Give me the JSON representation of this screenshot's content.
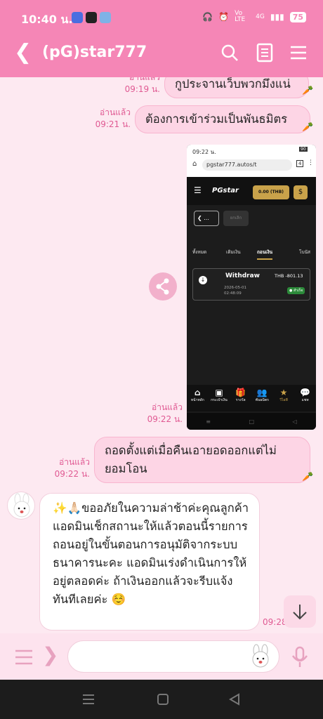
{
  "status": {
    "time": "10:40 น.",
    "network": "Vo LTE",
    "signal": "4G",
    "battery": "75"
  },
  "header": {
    "title": "(pG)star777"
  },
  "messages": {
    "m1": {
      "text": "กูประจานเว็บพวกมึงแน่",
      "read": "อ่านแล้ว",
      "time": "09:19 น."
    },
    "m2": {
      "text": "ต้องการเข้าร่วมเป็นพันธมิตร",
      "read": "อ่านแล้ว",
      "time": "09:21 น."
    },
    "m3": {
      "read": "อ่านแล้ว",
      "time": "09:22 น."
    },
    "m4": {
      "text": "ถอดตั้งแต่เมื่อคืนเอายอดออกแต่ไม่ยอมโอน",
      "read": "อ่านแล้ว",
      "time": "09:22 น."
    },
    "m5": {
      "text": "✨🙏🏻ขออภัยในความล่าช้าค่ะคุณลูกค้า แอดมินเช็กสถานะให้แล้วตอนนี้รายการถอนอยู่ในขั้นตอนการอนุมัติจากระบบธนาคารนะคะ แอดมินเร่งดำเนินการให้อยู่ตลอดค่ะ ถ้าเงินออกแล้วจะรีบแจ้งทันทีเลยค่ะ ☺️",
      "time": "09:28"
    }
  },
  "screenshot": {
    "time": "09:22 น.",
    "url": "pgstar777.autos/t",
    "tab_count": "4",
    "logo": "PGstar",
    "balance": "0.00 (THB)",
    "back_label": "...",
    "filter_label": "ยกเลิก",
    "tabs": [
      "ทั้งหมด",
      "เติมเงิน",
      "ถอนเงิน",
      "โบนัส"
    ],
    "txn": {
      "type": "Withdraw",
      "amount": "THB -801.13",
      "date": "2026-05-01",
      "clock": "02:48:09",
      "status": "● สำเร็จ"
    },
    "bottom_nav": [
      {
        "icon": "⌂",
        "label": "หน้าหลัก"
      },
      {
        "icon": "▣",
        "label": "กระเป๋าเงิน"
      },
      {
        "icon": "🎁",
        "label": "รางวัล"
      },
      {
        "icon": "👥",
        "label": "พันธมิตร"
      },
      {
        "icon": "★",
        "label": "วีไอพี"
      },
      {
        "icon": "💬",
        "label": "แชท"
      }
    ]
  },
  "colors": {
    "accent": "#f586b6",
    "bubble": "#fdd5e5",
    "background": "#fde9f1"
  }
}
